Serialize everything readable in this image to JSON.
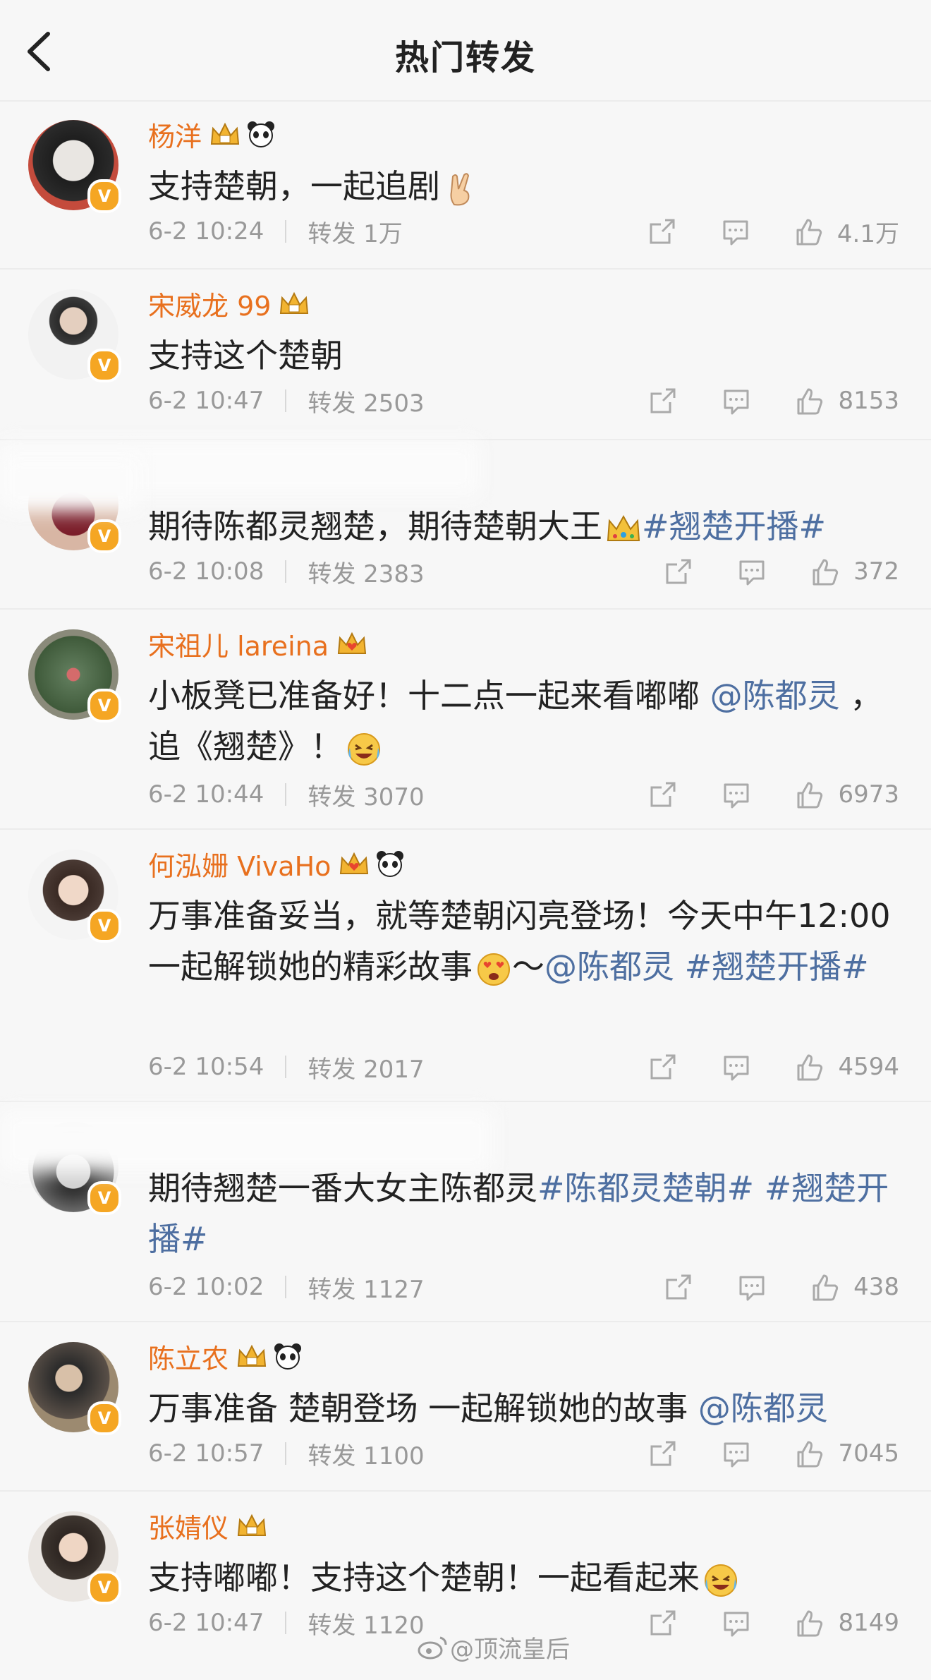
{
  "header": {
    "title": "热门转发"
  },
  "items": [
    {
      "name": "杨洋",
      "content_parts": [
        {
          "t": "支持楚朝，一起追剧",
          "c": "text"
        }
      ],
      "time": "6-2 10:24",
      "repost": "转发 1万",
      "likes": "4.1万"
    },
    {
      "name": "宋威龙 99",
      "content_parts": [
        {
          "t": "支持这个楚朝",
          "c": "text"
        }
      ],
      "time": "6-2 10:47",
      "repost": "转发 2503",
      "likes": "8153"
    },
    {
      "name": "",
      "content_parts": [
        {
          "t": "期待陈都灵翘楚，期待楚朝大王",
          "c": "text"
        },
        {
          "t": "#翘楚开播#",
          "c": "tag"
        }
      ],
      "time": "6-2 10:08",
      "repost": "转发 2383",
      "likes": "372"
    },
    {
      "name": "宋祖儿 lareina",
      "content_parts": [
        {
          "t": "小板凳已准备好！十二点一起来看嘟嘟 ",
          "c": "text"
        },
        {
          "t": "@陈都灵",
          "c": "mention"
        },
        {
          "t": " ，追《翘楚》！",
          "c": "text"
        }
      ],
      "time": "6-2 10:44",
      "repost": "转发 3070",
      "likes": "6973"
    },
    {
      "name": "何泓姗 VivaHo",
      "content_parts": [
        {
          "t": "万事准备妥当，就等楚朝闪亮登场！今天中午12:00一起解锁她的精彩故事",
          "c": "text"
        },
        {
          "t": "～",
          "c": "text"
        },
        {
          "t": "@陈都灵",
          "c": "mention"
        },
        {
          "t": " ",
          "c": "text"
        },
        {
          "t": "#翘楚开播#",
          "c": "tag"
        }
      ],
      "time": "6-2 10:54",
      "repost": "转发 2017",
      "likes": "4594"
    },
    {
      "name": "",
      "content_parts": [
        {
          "t": "期待翘楚一番大女主陈都灵",
          "c": "text"
        },
        {
          "t": "#陈都灵楚朝#",
          "c": "tag"
        },
        {
          "t": " ",
          "c": "text"
        },
        {
          "t": "#翘楚开播#",
          "c": "tag"
        }
      ],
      "time": "6-2 10:02",
      "repost": "转发 1127",
      "likes": "438"
    },
    {
      "name": "陈立农",
      "content_parts": [
        {
          "t": "万事准备 楚朝登场 一起解锁她的故事 ",
          "c": "text"
        },
        {
          "t": "@陈都灵",
          "c": "mention"
        }
      ],
      "time": "6-2 10:57",
      "repost": "转发 1100",
      "likes": "7045"
    },
    {
      "name": "张婧仪",
      "content_parts": [
        {
          "t": "支持嘟嘟！支持这个楚朝！一起看起来",
          "c": "text"
        }
      ],
      "time": "6-2 10:47",
      "repost": "转发 1120",
      "likes": "8149"
    }
  ],
  "watermark": "@顶流皇后",
  "colors": {
    "name": "#e8701e",
    "link": "#4e6fa1",
    "meta": "#999999",
    "badge": "#f5a623"
  }
}
